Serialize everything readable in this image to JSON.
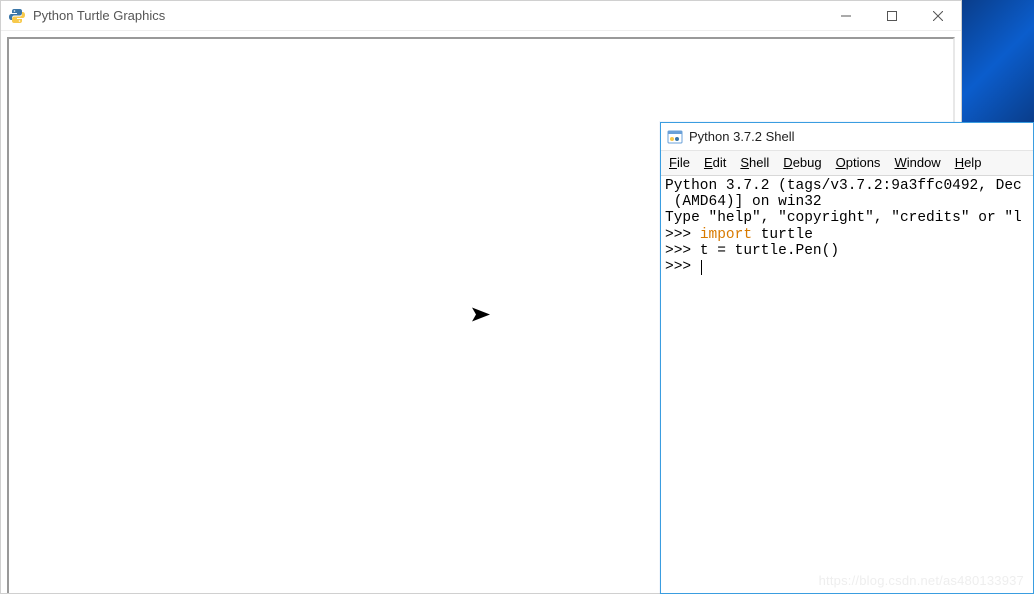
{
  "desktop": {},
  "turtle_window": {
    "title": "Python Turtle Graphics"
  },
  "shell_window": {
    "title": "Python 3.7.2 Shell",
    "menu": {
      "file": "File",
      "edit": "Edit",
      "shell": "Shell",
      "debug": "Debug",
      "options": "Options",
      "window": "Window",
      "help": "Help"
    },
    "banner_line1": "Python 3.7.2 (tags/v3.7.2:9a3ffc0492, Dec",
    "banner_line2": " (AMD64)] on win32",
    "banner_line3": "Type \"help\", \"copyright\", \"credits\" or \"l",
    "prompt": ">>>",
    "line1_kw": "import",
    "line1_rest": " turtle",
    "line2": "t = turtle.Pen()"
  },
  "watermark": "https://blog.csdn.net/as480133937"
}
